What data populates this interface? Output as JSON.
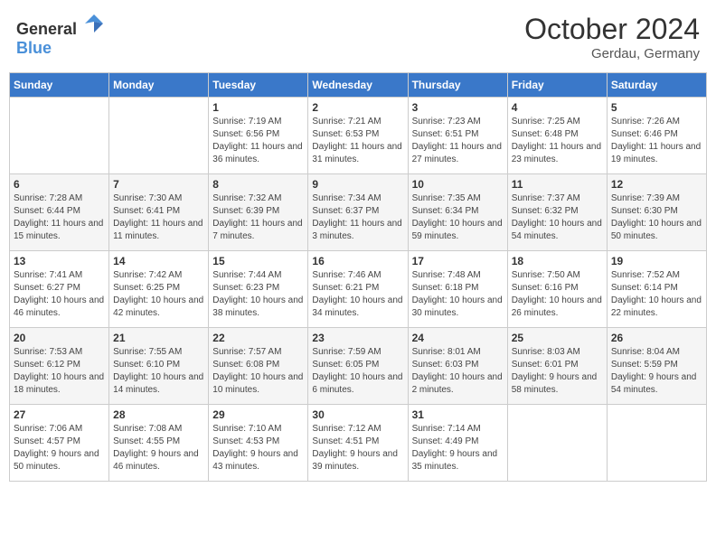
{
  "header": {
    "logo_general": "General",
    "logo_blue": "Blue",
    "month_title": "October 2024",
    "location": "Gerdau, Germany"
  },
  "weekdays": [
    "Sunday",
    "Monday",
    "Tuesday",
    "Wednesday",
    "Thursday",
    "Friday",
    "Saturday"
  ],
  "weeks": [
    [
      {
        "day": "",
        "info": ""
      },
      {
        "day": "",
        "info": ""
      },
      {
        "day": "1",
        "info": "Sunrise: 7:19 AM\nSunset: 6:56 PM\nDaylight: 11 hours and 36 minutes."
      },
      {
        "day": "2",
        "info": "Sunrise: 7:21 AM\nSunset: 6:53 PM\nDaylight: 11 hours and 31 minutes."
      },
      {
        "day": "3",
        "info": "Sunrise: 7:23 AM\nSunset: 6:51 PM\nDaylight: 11 hours and 27 minutes."
      },
      {
        "day": "4",
        "info": "Sunrise: 7:25 AM\nSunset: 6:48 PM\nDaylight: 11 hours and 23 minutes."
      },
      {
        "day": "5",
        "info": "Sunrise: 7:26 AM\nSunset: 6:46 PM\nDaylight: 11 hours and 19 minutes."
      }
    ],
    [
      {
        "day": "6",
        "info": "Sunrise: 7:28 AM\nSunset: 6:44 PM\nDaylight: 11 hours and 15 minutes."
      },
      {
        "day": "7",
        "info": "Sunrise: 7:30 AM\nSunset: 6:41 PM\nDaylight: 11 hours and 11 minutes."
      },
      {
        "day": "8",
        "info": "Sunrise: 7:32 AM\nSunset: 6:39 PM\nDaylight: 11 hours and 7 minutes."
      },
      {
        "day": "9",
        "info": "Sunrise: 7:34 AM\nSunset: 6:37 PM\nDaylight: 11 hours and 3 minutes."
      },
      {
        "day": "10",
        "info": "Sunrise: 7:35 AM\nSunset: 6:34 PM\nDaylight: 10 hours and 59 minutes."
      },
      {
        "day": "11",
        "info": "Sunrise: 7:37 AM\nSunset: 6:32 PM\nDaylight: 10 hours and 54 minutes."
      },
      {
        "day": "12",
        "info": "Sunrise: 7:39 AM\nSunset: 6:30 PM\nDaylight: 10 hours and 50 minutes."
      }
    ],
    [
      {
        "day": "13",
        "info": "Sunrise: 7:41 AM\nSunset: 6:27 PM\nDaylight: 10 hours and 46 minutes."
      },
      {
        "day": "14",
        "info": "Sunrise: 7:42 AM\nSunset: 6:25 PM\nDaylight: 10 hours and 42 minutes."
      },
      {
        "day": "15",
        "info": "Sunrise: 7:44 AM\nSunset: 6:23 PM\nDaylight: 10 hours and 38 minutes."
      },
      {
        "day": "16",
        "info": "Sunrise: 7:46 AM\nSunset: 6:21 PM\nDaylight: 10 hours and 34 minutes."
      },
      {
        "day": "17",
        "info": "Sunrise: 7:48 AM\nSunset: 6:18 PM\nDaylight: 10 hours and 30 minutes."
      },
      {
        "day": "18",
        "info": "Sunrise: 7:50 AM\nSunset: 6:16 PM\nDaylight: 10 hours and 26 minutes."
      },
      {
        "day": "19",
        "info": "Sunrise: 7:52 AM\nSunset: 6:14 PM\nDaylight: 10 hours and 22 minutes."
      }
    ],
    [
      {
        "day": "20",
        "info": "Sunrise: 7:53 AM\nSunset: 6:12 PM\nDaylight: 10 hours and 18 minutes."
      },
      {
        "day": "21",
        "info": "Sunrise: 7:55 AM\nSunset: 6:10 PM\nDaylight: 10 hours and 14 minutes."
      },
      {
        "day": "22",
        "info": "Sunrise: 7:57 AM\nSunset: 6:08 PM\nDaylight: 10 hours and 10 minutes."
      },
      {
        "day": "23",
        "info": "Sunrise: 7:59 AM\nSunset: 6:05 PM\nDaylight: 10 hours and 6 minutes."
      },
      {
        "day": "24",
        "info": "Sunrise: 8:01 AM\nSunset: 6:03 PM\nDaylight: 10 hours and 2 minutes."
      },
      {
        "day": "25",
        "info": "Sunrise: 8:03 AM\nSunset: 6:01 PM\nDaylight: 9 hours and 58 minutes."
      },
      {
        "day": "26",
        "info": "Sunrise: 8:04 AM\nSunset: 5:59 PM\nDaylight: 9 hours and 54 minutes."
      }
    ],
    [
      {
        "day": "27",
        "info": "Sunrise: 7:06 AM\nSunset: 4:57 PM\nDaylight: 9 hours and 50 minutes."
      },
      {
        "day": "28",
        "info": "Sunrise: 7:08 AM\nSunset: 4:55 PM\nDaylight: 9 hours and 46 minutes."
      },
      {
        "day": "29",
        "info": "Sunrise: 7:10 AM\nSunset: 4:53 PM\nDaylight: 9 hours and 43 minutes."
      },
      {
        "day": "30",
        "info": "Sunrise: 7:12 AM\nSunset: 4:51 PM\nDaylight: 9 hours and 39 minutes."
      },
      {
        "day": "31",
        "info": "Sunrise: 7:14 AM\nSunset: 4:49 PM\nDaylight: 9 hours and 35 minutes."
      },
      {
        "day": "",
        "info": ""
      },
      {
        "day": "",
        "info": ""
      }
    ]
  ]
}
